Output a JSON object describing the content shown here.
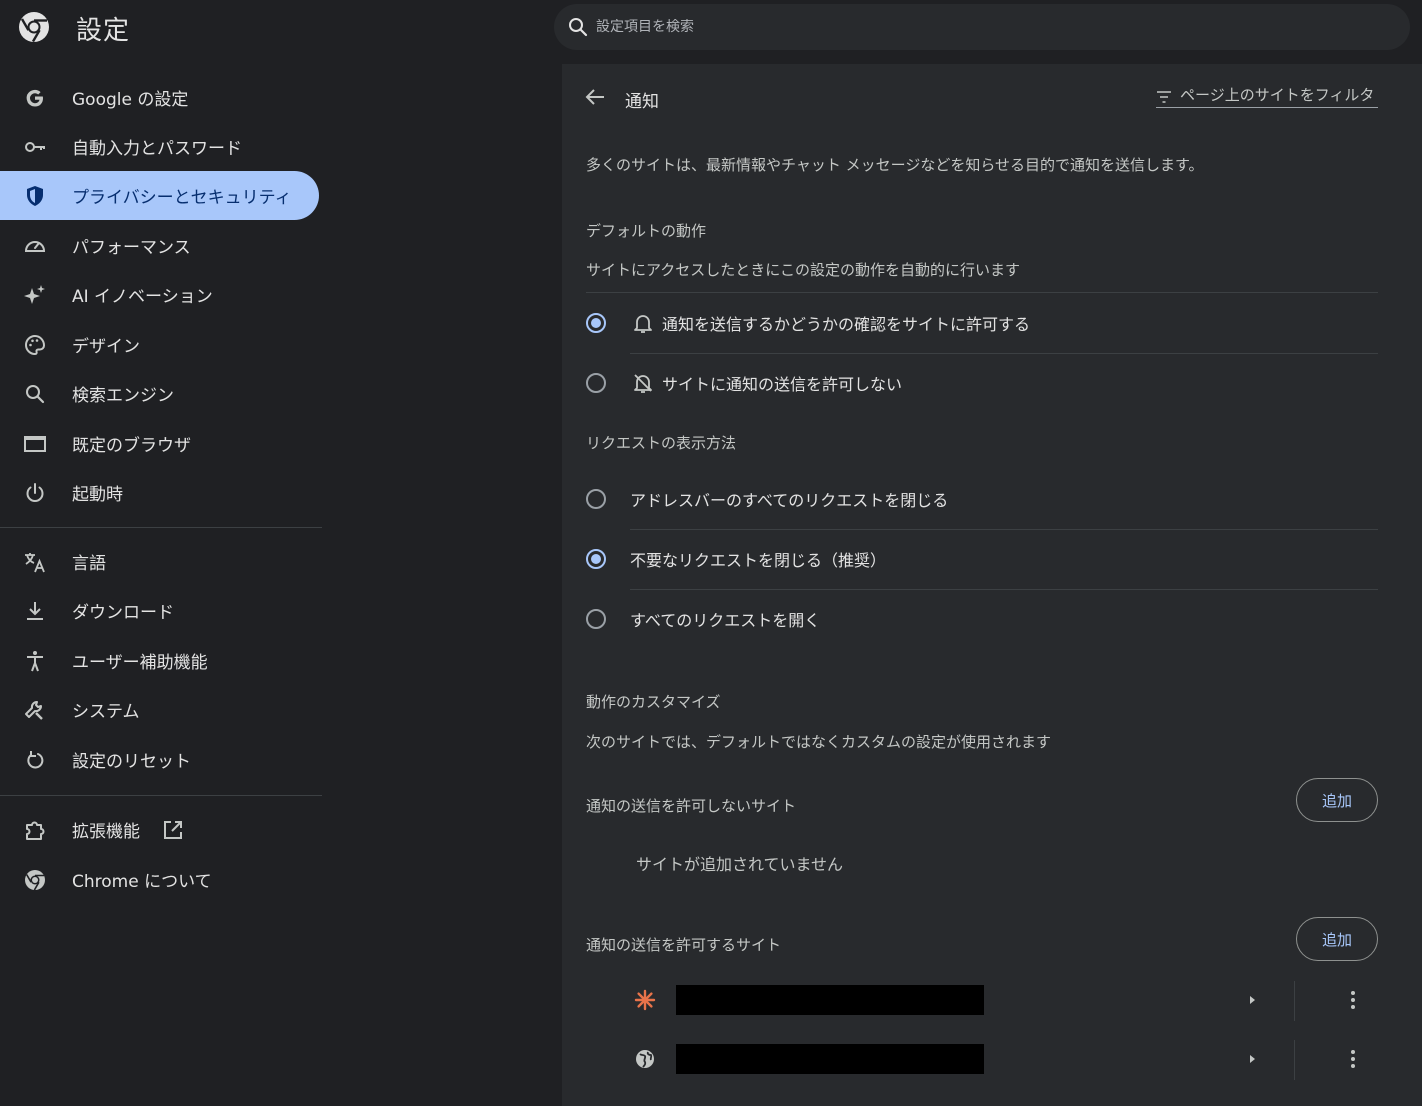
{
  "header": {
    "title": "設定",
    "search_placeholder": "設定項目を検索"
  },
  "sidebar": {
    "items": [
      {
        "label": "Google の設定",
        "icon": "google-g-icon"
      },
      {
        "label": "自動入力とパスワード",
        "icon": "key-icon"
      },
      {
        "label": "プライバシーとセキュリティ",
        "icon": "shield-icon",
        "active": true
      },
      {
        "label": "パフォーマンス",
        "icon": "speedometer-icon"
      },
      {
        "label": "AI イノベーション",
        "icon": "sparkle-icon"
      },
      {
        "label": "デザイン",
        "icon": "palette-icon"
      },
      {
        "label": "検索エンジン",
        "icon": "search-icon"
      },
      {
        "label": "既定のブラウザ",
        "icon": "browser-window-icon"
      },
      {
        "label": "起動時",
        "icon": "power-icon"
      },
      {
        "label": "言語",
        "icon": "translate-icon"
      },
      {
        "label": "ダウンロード",
        "icon": "download-icon"
      },
      {
        "label": "ユーザー補助機能",
        "icon": "accessibility-icon"
      },
      {
        "label": "システム",
        "icon": "wrench-icon"
      },
      {
        "label": "設定のリセット",
        "icon": "reset-icon"
      },
      {
        "label": "拡張機能",
        "icon": "puzzle-icon"
      },
      {
        "label": "Chrome について",
        "icon": "chrome-icon"
      }
    ]
  },
  "panel": {
    "title": "通知",
    "filter_label": "ページ上のサイトをフィルタ",
    "description": "多くのサイトは、最新情報やチャット メッセージなどを知らせる目的で通知を送信します。",
    "default_behavior": {
      "title": "デフォルトの動作",
      "subtitle": "サイトにアクセスしたときにこの設定の動作を自動的に行います",
      "options": [
        {
          "label": "通知を送信するかどうかの確認をサイトに許可する",
          "icon": "bell-icon",
          "checked": true
        },
        {
          "label": "サイトに通知の送信を許可しない",
          "icon": "bell-off-icon",
          "checked": false
        }
      ]
    },
    "request_display": {
      "title": "リクエストの表示方法",
      "options": [
        {
          "label": "アドレスバーのすべてのリクエストを閉じる",
          "checked": false
        },
        {
          "label": "不要なリクエストを閉じる（推奨）",
          "checked": true
        },
        {
          "label": "すべてのリクエストを開く",
          "checked": false
        }
      ]
    },
    "customize": {
      "title": "動作のカスタマイズ",
      "subtitle": "次のサイトでは、デフォルトではなくカスタムの設定が使用されます"
    },
    "blocked_sites": {
      "title": "通知の送信を許可しないサイト",
      "add_label": "追加",
      "empty_text": "サイトが追加されていません"
    },
    "allowed_sites": {
      "title": "通知の送信を許可するサイト",
      "add_label": "追加",
      "sites": [
        {
          "icon": "asterisk-favicon-icon",
          "icon_color": "#e8734a"
        },
        {
          "icon": "globe-icon",
          "icon_color": "#c4c7c5"
        }
      ]
    }
  },
  "colors": {
    "accent": "#a8c7fa",
    "background": "#1f2023",
    "panel": "#282a2d"
  }
}
